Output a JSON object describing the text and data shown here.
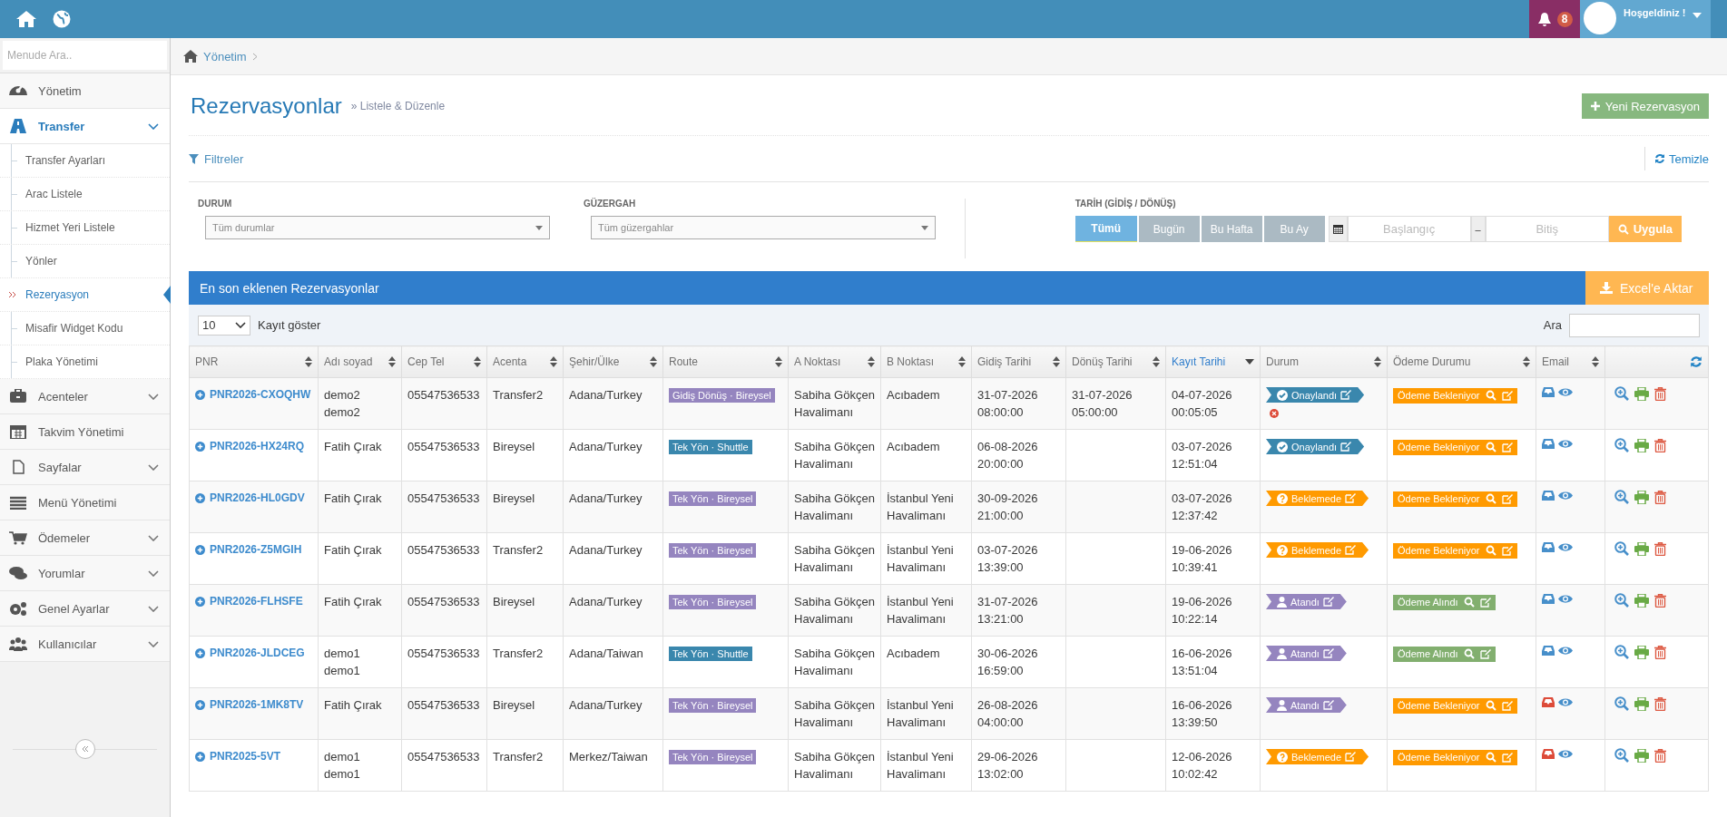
{
  "topbar": {
    "notifications": "8",
    "greeting": "Hoşgeldiniz !"
  },
  "sidebar": {
    "search_placeholder": "Menude Ara..",
    "items": [
      {
        "label": "Yönetim",
        "expandable": false,
        "selected": false
      },
      {
        "label": "Transfer",
        "expandable": true,
        "expanded": true,
        "selected": true,
        "children": [
          {
            "label": "Transfer Ayarları",
            "selected": false
          },
          {
            "label": "Arac Listele",
            "selected": false
          },
          {
            "label": "Hizmet Yeri Listele",
            "selected": false
          },
          {
            "label": "Yönler",
            "selected": false
          },
          {
            "label": "Rezeryasyon",
            "selected": true
          },
          {
            "label": "Misafir Widget Kodu",
            "selected": false
          },
          {
            "label": "Plaka Yönetimi",
            "selected": false
          }
        ]
      },
      {
        "label": "Acenteler",
        "expandable": true,
        "expanded": false,
        "selected": false
      },
      {
        "label": "Takvim Yönetimi",
        "expandable": false,
        "selected": false
      },
      {
        "label": "Sayfalar",
        "expandable": true,
        "expanded": false,
        "selected": false
      },
      {
        "label": "Menü Yönetimi",
        "expandable": false,
        "selected": false
      },
      {
        "label": "Ödemeler",
        "expandable": true,
        "expanded": false,
        "selected": false
      },
      {
        "label": "Yorumlar",
        "expandable": true,
        "expanded": false,
        "selected": false
      },
      {
        "label": "Genel Ayarlar",
        "expandable": true,
        "expanded": false,
        "selected": false
      },
      {
        "label": "Kullanıcılar",
        "expandable": true,
        "expanded": false,
        "selected": false
      }
    ]
  },
  "breadcrumb": [
    "Yönetim"
  ],
  "page": {
    "title": "Rezervasyonlar",
    "subtitle": "» Listele & Düzenle",
    "new_button": "Yeni Rezervasyon"
  },
  "filters": {
    "title": "Filtreler",
    "clear": "Temizle",
    "status": {
      "label": "DURUM",
      "placeholder": "Tüm durumlar"
    },
    "route": {
      "label": "GÜZERGAH",
      "placeholder": "Tüm güzergahlar"
    },
    "date": {
      "label": "TARİH (GİDİŞ / DÖNÜŞ)",
      "ranges": [
        {
          "label": "Tümü",
          "selected": true
        },
        {
          "label": "Bugün",
          "selected": false
        },
        {
          "label": "Bu Hafta",
          "selected": false
        },
        {
          "label": "Bu Ay",
          "selected": false
        }
      ],
      "start_placeholder": "Başlangıç",
      "separator": "–",
      "end_placeholder": "Bitiş",
      "apply": "Uygula"
    }
  },
  "panel": {
    "title": "En son eklenen Rezervasyonlar",
    "export": "Excel'e Aktar",
    "page_size": "10",
    "page_size_label": "Kayıt göster",
    "search_label": "Ara"
  },
  "table": {
    "columns": [
      {
        "label": "PNR",
        "sorted": false
      },
      {
        "label": "Adı soyad",
        "sorted": false
      },
      {
        "label": "Cep Tel",
        "sorted": false
      },
      {
        "label": "Acenta",
        "sorted": false
      },
      {
        "label": "Şehir/Ülke",
        "sorted": false
      },
      {
        "label": "Route",
        "sorted": false
      },
      {
        "label": "A Noktası",
        "sorted": false
      },
      {
        "label": "B Noktası",
        "sorted": false
      },
      {
        "label": "Gidiş Tarihi",
        "sorted": false
      },
      {
        "label": "Dönüş Tarihi",
        "sorted": false
      },
      {
        "label": "Kayıt Tarihi",
        "sorted": true
      },
      {
        "label": "Durum",
        "sorted": false
      },
      {
        "label": "Ödeme Durumu",
        "sorted": false
      },
      {
        "label": "Email",
        "sorted": false
      }
    ],
    "rows": [
      {
        "pnr": "PNR2026-CXOQHW",
        "name": "demo2 demo2",
        "phone": "05547536533",
        "agency": "Transfer2",
        "city": "Adana/Turkey",
        "route": {
          "label": "Gidiş Dönüş · Bireysel",
          "kind": "individual"
        },
        "from": "Sabiha Gökçen Havalimanı",
        "to": "Acıbadem",
        "departure": "31-07-2026 08:00:00",
        "return": "31-07-2026 05:00:00",
        "created": "04-07-2026 00:05:05",
        "status": {
          "label": "Onaylandı",
          "kind": "approved",
          "cancel": true
        },
        "payment": {
          "label": "Ödeme Bekleniyor",
          "kind": "pending"
        },
        "email_failed": false
      },
      {
        "pnr": "PNR2026-HX24RQ",
        "name": "Fatih Çırak",
        "phone": "05547536533",
        "agency": "Bireysel",
        "city": "Adana/Turkey",
        "route": {
          "label": "Tek Yön · Shuttle",
          "kind": "shuttle"
        },
        "from": "Sabiha Gökçen Havalimanı",
        "to": "Acıbadem",
        "departure": "06-08-2026 20:00:00",
        "created": "03-07-2026 12:51:04",
        "status": {
          "label": "Onaylandı",
          "kind": "approved",
          "cancel": false
        },
        "payment": {
          "label": "Ödeme Bekleniyor",
          "kind": "pending"
        },
        "email_failed": false
      },
      {
        "pnr": "PNR2026-HL0GDV",
        "name": "Fatih Çırak",
        "phone": "05547536533",
        "agency": "Bireysel",
        "city": "Adana/Turkey",
        "route": {
          "label": "Tek Yön · Bireysel",
          "kind": "individual"
        },
        "from": "Sabiha Gökçen Havalimanı",
        "to": "İstanbul Yeni Havalimanı",
        "departure": "30-09-2026 21:00:00",
        "created": "03-07-2026 12:37:42",
        "status": {
          "label": "Beklemede",
          "kind": "waiting",
          "cancel": false
        },
        "payment": {
          "label": "Ödeme Bekleniyor",
          "kind": "pending"
        },
        "email_failed": false
      },
      {
        "pnr": "PNR2026-Z5MGIH",
        "name": "Fatih Çırak",
        "phone": "05547536533",
        "agency": "Transfer2",
        "city": "Adana/Turkey",
        "route": {
          "label": "Tek Yön · Bireysel",
          "kind": "individual"
        },
        "from": "Sabiha Gökçen Havalimanı",
        "to": "İstanbul Yeni Havalimanı",
        "departure": "03-07-2026 13:39:00",
        "created": "19-06-2026 10:39:41",
        "status": {
          "label": "Beklemede",
          "kind": "waiting",
          "cancel": false
        },
        "payment": {
          "label": "Ödeme Bekleniyor",
          "kind": "pending"
        },
        "email_failed": false
      },
      {
        "pnr": "PNR2026-FLHSFE",
        "name": "Fatih Çırak",
        "phone": "05547536533",
        "agency": "Bireysel",
        "city": "Adana/Turkey",
        "route": {
          "label": "Tek Yön · Bireysel",
          "kind": "individual"
        },
        "from": "Sabiha Gökçen Havalimanı",
        "to": "İstanbul Yeni Havalimanı",
        "departure": "31-07-2026 13:21:00",
        "created": "19-06-2026 10:22:14",
        "status": {
          "label": "Atandı",
          "kind": "assigned",
          "cancel": false
        },
        "payment": {
          "label": "Ödeme Alındı",
          "kind": "paid"
        },
        "email_failed": false
      },
      {
        "pnr": "PNR2026-JLDCEG",
        "name": "demo1 demo1",
        "phone": "05547536533",
        "agency": "Transfer2",
        "city": "Adana/Taiwan",
        "route": {
          "label": "Tek Yön · Shuttle",
          "kind": "shuttle"
        },
        "from": "Sabiha Gökçen Havalimanı",
        "to": "Acıbadem",
        "departure": "30-06-2026 16:59:00",
        "created": "16-06-2026 13:51:04",
        "status": {
          "label": "Atandı",
          "kind": "assigned",
          "cancel": false
        },
        "payment": {
          "label": "Ödeme Alındı",
          "kind": "paid"
        },
        "email_failed": false
      },
      {
        "pnr": "PNR2026-1MK8TV",
        "name": "Fatih Çırak",
        "phone": "05547536533",
        "agency": "Bireysel",
        "city": "Adana/Turkey",
        "route": {
          "label": "Tek Yön · Bireysel",
          "kind": "individual"
        },
        "from": "Sabiha Gökçen Havalimanı",
        "to": "İstanbul Yeni Havalimanı",
        "departure": "26-08-2026 04:00:00",
        "created": "16-06-2026 13:39:50",
        "status": {
          "label": "Atandı",
          "kind": "assigned",
          "cancel": false
        },
        "payment": {
          "label": "Ödeme Bekleniyor",
          "kind": "pending"
        },
        "email_failed": true
      },
      {
        "pnr": "PNR2025-5VT",
        "name": "demo1 demo1",
        "phone": "05547536533",
        "agency": "Transfer2",
        "city": "Merkez/Taiwan",
        "route": {
          "label": "Tek Yön · Bireysel",
          "kind": "individual"
        },
        "from": "Sabiha Gökçen Havalimanı",
        "to": "İstanbul Yeni Havalimanı",
        "departure": "29-06-2026 13:02:00",
        "created": "12-06-2026 10:02:42",
        "status": {
          "label": "Beklemede",
          "kind": "waiting",
          "cancel": false
        },
        "payment": {
          "label": "Ödeme Bekleniyor",
          "kind": "pending"
        },
        "email_failed": true
      }
    ]
  }
}
